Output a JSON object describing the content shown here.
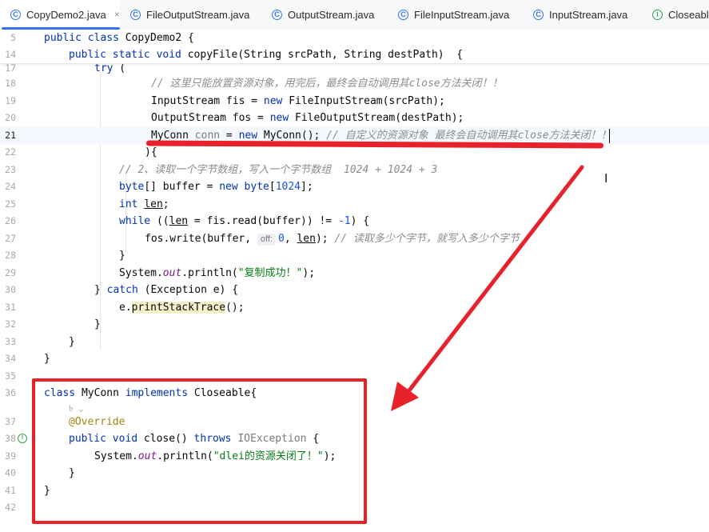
{
  "tabs": [
    {
      "label": "CopyDemo2.java",
      "icon": "class-icon",
      "active": true,
      "closable": true
    },
    {
      "label": "FileOutputStream.java",
      "icon": "class-icon"
    },
    {
      "label": "OutputStream.java",
      "icon": "class-icon"
    },
    {
      "label": "FileInputStream.java",
      "icon": "class-icon"
    },
    {
      "label": "InputStream.java",
      "icon": "class-icon"
    },
    {
      "label": "Closeable",
      "icon": "interface-icon"
    }
  ],
  "tab_close_glyph": "×",
  "line_numbers": {
    "s5": "5",
    "s14": "14",
    "l17": "17",
    "l18": "18",
    "l19": "19",
    "l20": "20",
    "l21": "21",
    "l22": "22",
    "l23": "23",
    "l24": "24",
    "l25": "25",
    "l26": "26",
    "l27": "27",
    "l28": "28",
    "l29": "29",
    "l30": "30",
    "l31": "31",
    "l32": "32",
    "l33": "33",
    "l34": "34",
    "l35": "35",
    "l36": "36",
    "l37": "37",
    "l38": "38",
    "l39": "39",
    "l40": "40",
    "l41": "41"
  },
  "code": {
    "s5": {
      "kw": "public class ",
      "rest": "CopyDemo2 {"
    },
    "s14": {
      "kw1": "public static void ",
      "name": "copyFile",
      "rest": "(String srcPath, String destPath)  {"
    },
    "l17": {
      "kw": "try",
      "rest": " ("
    },
    "l18": {
      "comment": "// 这里只能放置资源对象，用完后，最终会自动调用其close方法关闭！！"
    },
    "l19": {
      "a": "InputStream fis = ",
      "kw": "new",
      "b": " FileInputStream(srcPath);"
    },
    "l20": {
      "a": "OutputStream fos = ",
      "kw": "new",
      "b": " FileOutputStream(destPath);"
    },
    "l21": {
      "a": "MyConn ",
      "var": "conn",
      "b": " = ",
      "kw": "new",
      "c": " MyConn(); ",
      "comment": "// 自定义的资源对象 最终会自动调用其close方法关闭！！"
    },
    "l22": {
      "a": "){"
    },
    "l23": {
      "comment": "// 2、读取一个字节数组，写入一个字节数组  1024 + 1024 + 3"
    },
    "l24": {
      "kw": "byte",
      "a": "[] buffer = ",
      "kw2": "new",
      "b": " ",
      "kw3": "byte",
      "c": "[",
      "num": "1024",
      "d": "];"
    },
    "l25": {
      "kw": "int",
      "a": " ",
      "var": "len",
      "b": ";"
    },
    "l26": {
      "kw": "while",
      "a": " ((",
      "var": "len",
      "b": " = fis.read(buffer)) != ",
      "num": "-1",
      "c": ") {"
    },
    "l27": {
      "a": "fos.write(buffer, ",
      "hint": "off:",
      "num": "0",
      "b": ", ",
      "var": "len",
      "c": "); ",
      "comment": "// 读取多少个字节，就写入多少个字节"
    },
    "l28": {
      "a": "}"
    },
    "l29": {
      "a": "System.",
      "field": "out",
      "b": ".println(",
      "str": "\"复制成功！\"",
      "c": ");"
    },
    "l30": {
      "a": "} ",
      "kw": "catch",
      "b": " (Exception e) {"
    },
    "l31": {
      "a": "e.",
      "method": "printStackTrace",
      "b": "();"
    },
    "l32": {
      "a": "}"
    },
    "l33": {
      "a": "}"
    },
    "l34": {
      "a": "}"
    },
    "l36": {
      "kw": "class",
      "a": " MyConn ",
      "kw2": "implements",
      "b": " Closeable{"
    },
    "l36hint": {
      "a": "৳ ⌄"
    },
    "l37": {
      "anno": "@Override"
    },
    "l38": {
      "kw": "public void ",
      "name": "close",
      "a": "() ",
      "kw2": "throws",
      "b": " ",
      "gray": "IOException",
      "c": " {"
    },
    "l39": {
      "a": "System.",
      "field": "out",
      "b": ".println(",
      "str": "\"dlei的资源关闭了！\"",
      "c": ");"
    },
    "l40": {
      "a": "}"
    },
    "l41": {
      "a": "}"
    }
  },
  "mouse_cursor": "I",
  "colors": {
    "accent": "#3574f0",
    "annotation_red": "#e8222b",
    "keyword": "#0033b3",
    "string": "#067d17",
    "comment": "#8c8c8c"
  }
}
